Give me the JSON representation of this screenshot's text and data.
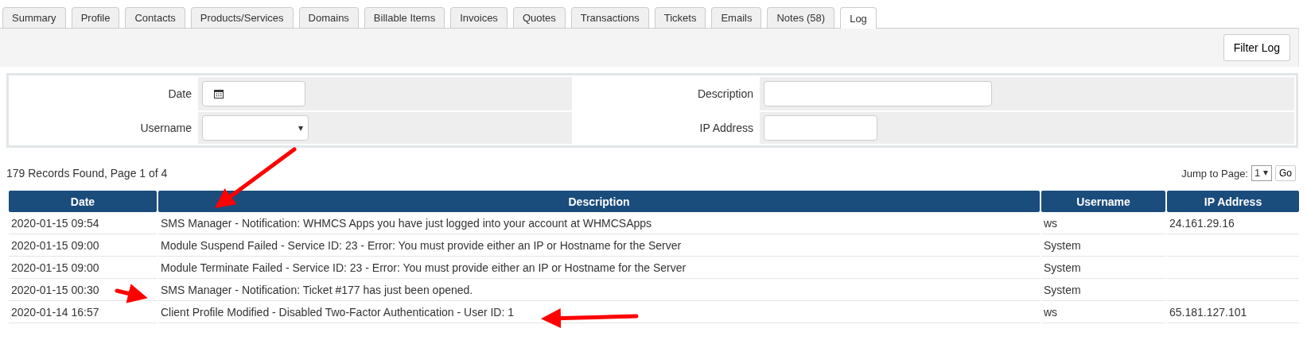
{
  "tabs": [
    {
      "label": "Summary",
      "selected": false
    },
    {
      "label": "Profile",
      "selected": false
    },
    {
      "label": "Contacts",
      "selected": false
    },
    {
      "label": "Products/Services",
      "selected": false
    },
    {
      "label": "Domains",
      "selected": false
    },
    {
      "label": "Billable Items",
      "selected": false
    },
    {
      "label": "Invoices",
      "selected": false
    },
    {
      "label": "Quotes",
      "selected": false
    },
    {
      "label": "Transactions",
      "selected": false
    },
    {
      "label": "Tickets",
      "selected": false
    },
    {
      "label": "Emails",
      "selected": false
    },
    {
      "label": "Notes (58)",
      "selected": false
    },
    {
      "label": "Log",
      "selected": true
    }
  ],
  "toolbar": {
    "button": "Filter Log"
  },
  "filters": [
    {
      "label": "Date",
      "kind": "date"
    },
    {
      "label": "Description",
      "kind": "text"
    },
    {
      "label": "Username",
      "kind": "select"
    },
    {
      "label": "IP Address",
      "kind": "text"
    }
  ],
  "records_found": "179 Records Found, Page 1 of 4",
  "pager": {
    "label": "Jump to Page:",
    "page": "1",
    "button": "Go"
  },
  "table": {
    "columns": [
      "Date",
      "Description",
      "Username",
      "IP Address"
    ],
    "rows": [
      [
        "2020-01-15 09:54",
        "SMS Manager - Notification: WHMCS Apps you have just logged into your account at WHMCSApps",
        "ws",
        "24.161.29.16"
      ],
      [
        "2020-01-15 09:00",
        "Module Suspend Failed - Service ID: 23 - Error: You must provide either an IP or Hostname for the Server",
        "System",
        ""
      ],
      [
        "2020-01-15 09:00",
        "Module Terminate Failed - Service ID: 23 - Error: You must provide either an IP or Hostname for the Server",
        "System",
        ""
      ],
      [
        "2020-01-15 00:30",
        "SMS Manager - Notification: Ticket #177 has just been opened.",
        "System",
        ""
      ],
      [
        "2020-01-14 16:57",
        "Client Profile Modified - Disabled Two-Factor Authentication - User ID: 1",
        "ws",
        "65.181.127.101"
      ]
    ]
  }
}
